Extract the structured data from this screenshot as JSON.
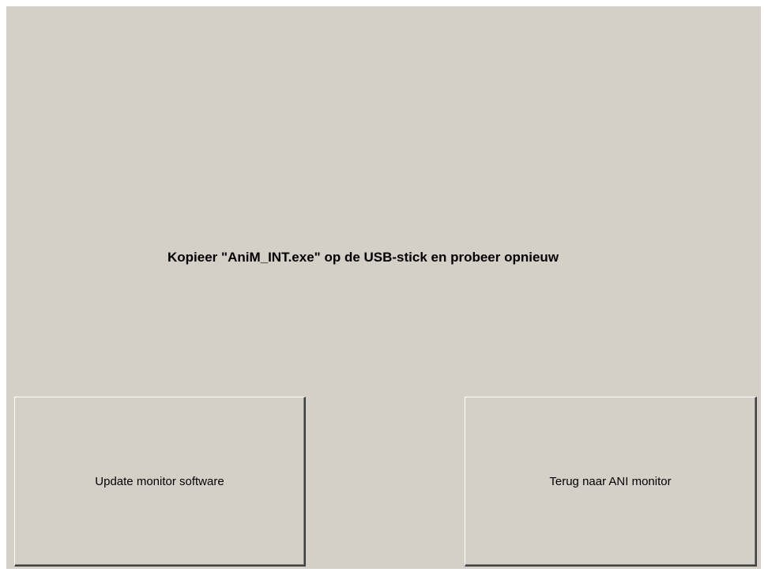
{
  "message": "Kopieer \"AniM_INT.exe\" op de USB-stick en probeer opnieuw",
  "buttons": {
    "update_label": "Update monitor software",
    "back_label": "Terug naar ANI monitor"
  },
  "colors": {
    "background": "#d4d0c8",
    "text": "#000000"
  }
}
